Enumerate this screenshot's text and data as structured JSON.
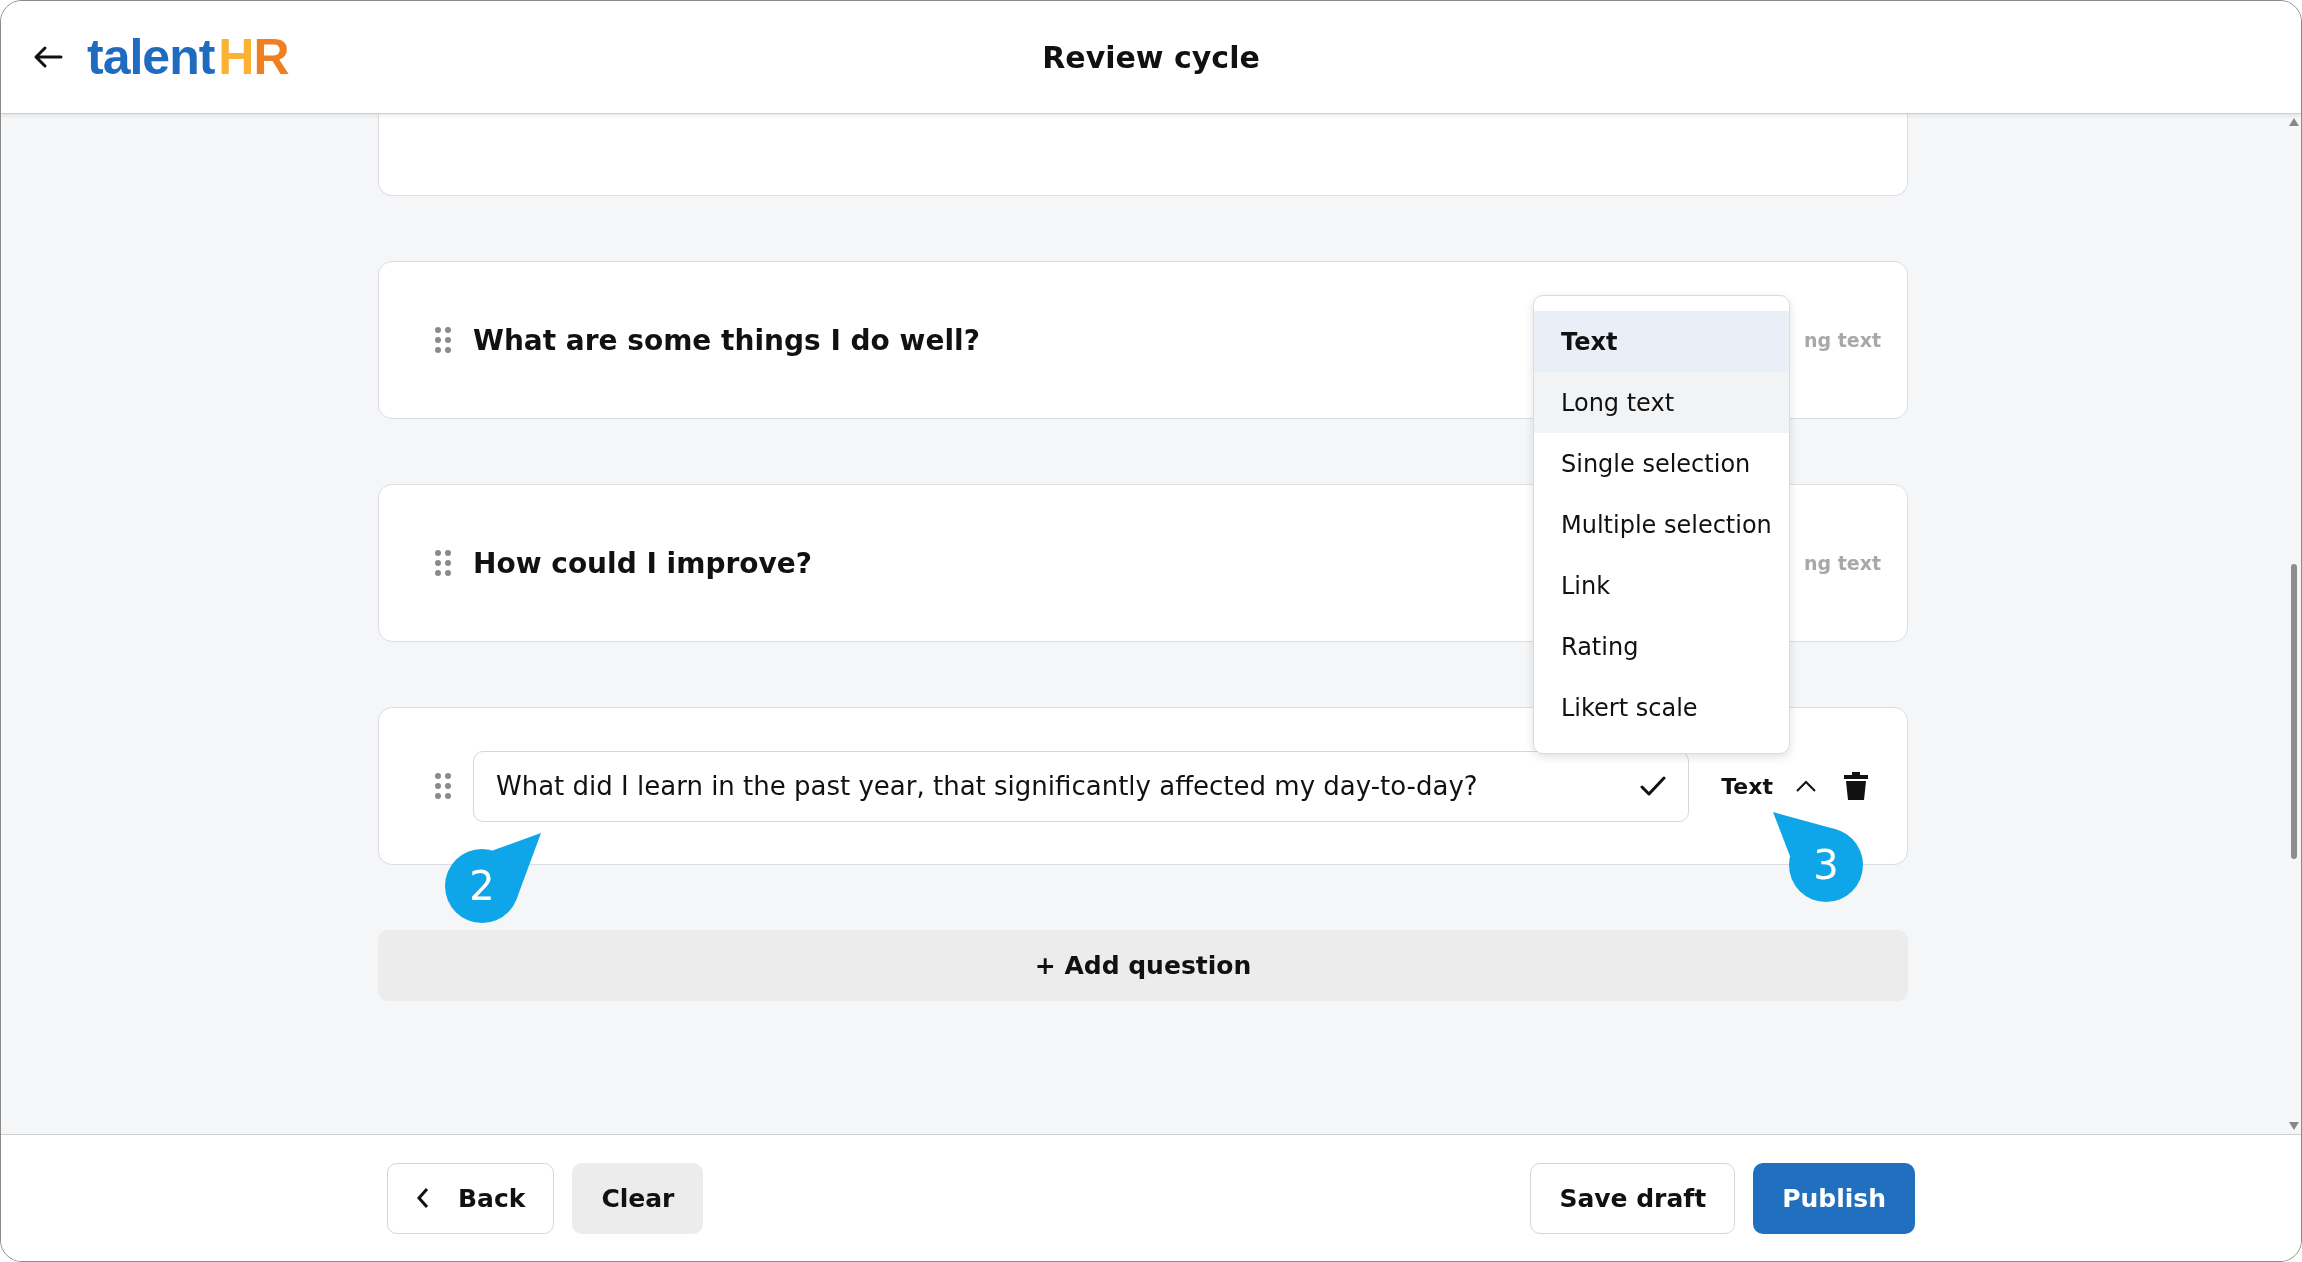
{
  "header": {
    "logo": {
      "text": "talent",
      "accent": "HR"
    },
    "title": "Review cycle"
  },
  "questions": [
    {
      "kind": "static",
      "text": "What are some things I do well?",
      "type_label": "ng text"
    },
    {
      "kind": "static",
      "text": "How could I improve?",
      "type_label": "ng text"
    },
    {
      "kind": "editing",
      "value": "What did I learn in the past year, that significantly affected my day-to-day?",
      "type_label": "Text",
      "dropdown_open": true
    }
  ],
  "type_menu": {
    "options": [
      {
        "label": "Text",
        "selected": true,
        "hovered": false
      },
      {
        "label": "Long text",
        "selected": false,
        "hovered": true
      },
      {
        "label": "Single selection",
        "selected": false,
        "hovered": false
      },
      {
        "label": "Multiple selection",
        "selected": false,
        "hovered": false
      },
      {
        "label": "Link",
        "selected": false,
        "hovered": false
      },
      {
        "label": "Rating",
        "selected": false,
        "hovered": false
      },
      {
        "label": "Likert scale",
        "selected": false,
        "hovered": false
      }
    ]
  },
  "add_question": "+ Add question",
  "callouts": [
    "2",
    "3"
  ],
  "footer": {
    "back": "Back",
    "clear": "Clear",
    "save_draft": "Save draft",
    "publish": "Publish"
  }
}
